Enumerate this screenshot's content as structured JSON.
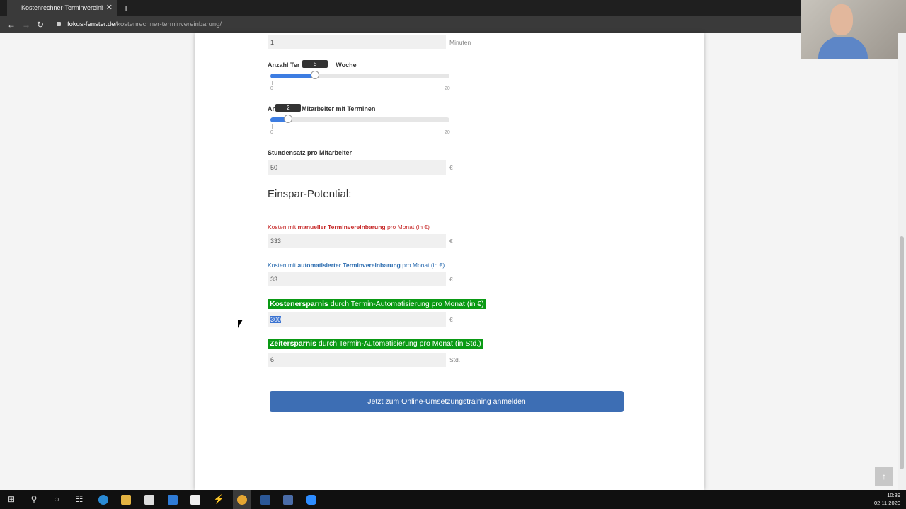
{
  "browser": {
    "tab_title": "Kostenrechner-Terminvereinbaru",
    "tab_close": "✕",
    "new_tab": "+",
    "url_domain": "fokus-fenster.de",
    "url_path": "/kostenrechner-terminvereinbarung/"
  },
  "form": {
    "minutes_value": "1",
    "minutes_unit": "Minuten",
    "slider1": {
      "label_a": "Anzahl Ter",
      "label_b": "Woche",
      "value": "5",
      "value_num": 5,
      "min": "0",
      "max": "20"
    },
    "slider2": {
      "label_a": "An",
      "label_b": "Mitarbeiter mit Terminen",
      "value": "2",
      "value_num": 2,
      "min": "0",
      "max": "20"
    },
    "hourly_label": "Stundensatz pro Mitarbeiter",
    "hourly_value": "50",
    "hourly_unit": "€"
  },
  "results": {
    "title": "Einspar-Potential:",
    "manual_prefix": "Kosten mit ",
    "manual_bold": "manueller Terminvereinbarung",
    "manual_suffix": " pro Monat (in €)",
    "manual_value": "333",
    "auto_prefix": "Kosten mit ",
    "auto_bold": "automatisierter Terminvereinbarung",
    "auto_suffix": " pro Monat (in €)",
    "auto_value": "33",
    "savings_bold": "Kostenersparnis",
    "savings_text": " durch Termin-Automatisierung pro Monat (in €)",
    "savings_value": "300",
    "time_bold": "Zeitersparnis",
    "time_text": " durch Termin-Automatisierung pro Monat (in Std.)",
    "time_value": "6",
    "time_unit": "Std.",
    "euro": "€"
  },
  "cta_label": "Jetzt zum Online-Umsetzungstraining anmelden",
  "clock": {
    "time": "10:39",
    "date": "02.11.2020"
  },
  "colors": {
    "accent": "#3d7de2",
    "green": "#0a9a14",
    "red": "#c62828",
    "cta": "#3d6eb4"
  }
}
